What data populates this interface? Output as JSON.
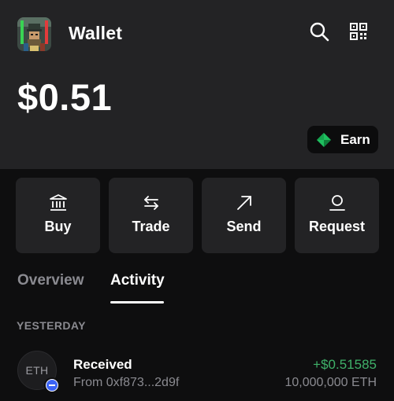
{
  "header": {
    "title": "Wallet",
    "avatar_icon": "pixel-art-avatar",
    "search_icon": "search-icon",
    "qr_icon": "qr-code-icon"
  },
  "balance": {
    "amount": "$0.51"
  },
  "earn_button": {
    "label": "Earn",
    "icon": "diamond-icon",
    "accent": "#1fbf5f"
  },
  "actions": [
    {
      "label": "Buy",
      "icon": "bank-icon"
    },
    {
      "label": "Trade",
      "icon": "swap-arrows-icon"
    },
    {
      "label": "Send",
      "icon": "arrow-up-right-icon"
    },
    {
      "label": "Request",
      "icon": "person-icon"
    }
  ],
  "tabs": [
    {
      "label": "Overview",
      "active": false
    },
    {
      "label": "Activity",
      "active": true
    }
  ],
  "activity": {
    "section_label": "YESTERDAY",
    "items": [
      {
        "title": "Received",
        "subtitle": "From 0xf873...2d9f",
        "token_symbol": "ETH",
        "amount": "+$0.51585",
        "token_amount": "10,000,000 ETH",
        "amount_color": "#3fb169"
      }
    ]
  }
}
